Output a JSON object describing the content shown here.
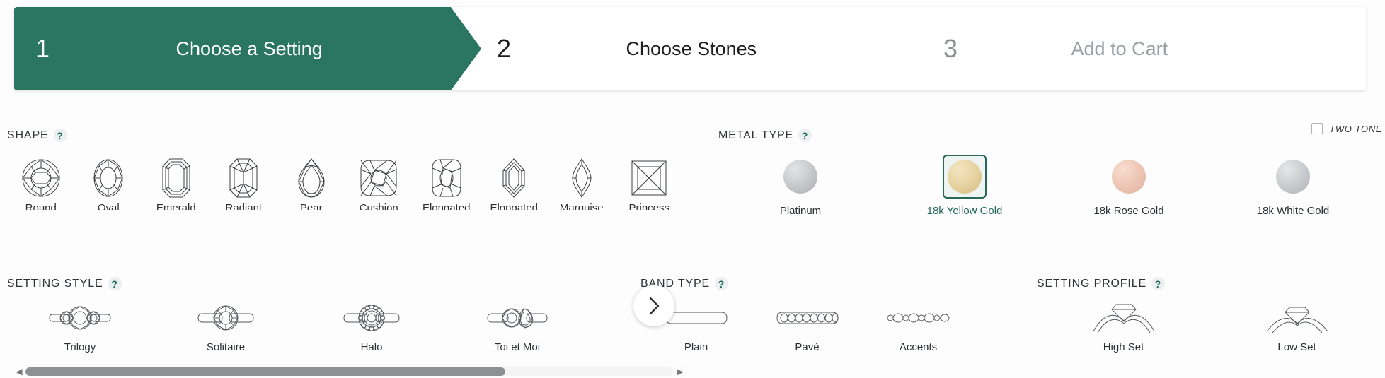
{
  "stepper": {
    "steps": [
      {
        "number": "1",
        "label": "Choose a Setting",
        "state": "active"
      },
      {
        "number": "2",
        "label": "Choose Stones",
        "state": "upcoming"
      },
      {
        "number": "3",
        "label": "Add to Cart",
        "state": "disabled"
      }
    ],
    "active_color": "#2b7563"
  },
  "shape": {
    "title": "SHAPE",
    "help": "?",
    "next_arrow": "chevron-right",
    "scroll_left_arrow": "◀",
    "scroll_right_arrow": "▶",
    "scroll_thumb_percent": 74,
    "options": [
      {
        "label": "Round",
        "icon": "round-diamond-icon"
      },
      {
        "label": "Oval",
        "icon": "oval-diamond-icon"
      },
      {
        "label": "Emerald",
        "icon": "emerald-diamond-icon"
      },
      {
        "label": "Radiant",
        "icon": "radiant-diamond-icon"
      },
      {
        "label": "Pear",
        "icon": "pear-diamond-icon"
      },
      {
        "label": "Cushion",
        "icon": "cushion-diamond-icon"
      },
      {
        "label": "Elongated Cushion",
        "icon": "elongated-cushion-diamond-icon"
      },
      {
        "label": "Elongated Hexagon",
        "icon": "elongated-hexagon-diamond-icon"
      },
      {
        "label": "Marquise",
        "icon": "marquise-diamond-icon"
      },
      {
        "label": "Princess",
        "icon": "princess-diamond-icon"
      }
    ]
  },
  "metal": {
    "title": "METAL TYPE",
    "help": "?",
    "two_tone_label": "TWO TONE",
    "two_tone_checked": false,
    "selected": "18k Yellow Gold",
    "options": [
      {
        "label": "Platinum",
        "color": "#c3c6c8",
        "selected": false
      },
      {
        "label": "18k Yellow Gold",
        "color": "#e8d3a4",
        "selected": true
      },
      {
        "label": "18k Rose Gold",
        "color": "#eec6b4",
        "selected": false
      },
      {
        "label": "18k White Gold",
        "color": "#c5c8ca",
        "selected": false
      }
    ]
  },
  "setting_style": {
    "title": "SETTING STYLE",
    "help": "?",
    "options": [
      {
        "label": "Trilogy",
        "icon": "trilogy-ring-icon"
      },
      {
        "label": "Solitaire",
        "icon": "solitaire-ring-icon"
      },
      {
        "label": "Halo",
        "icon": "halo-ring-icon"
      },
      {
        "label": "Toi et Moi",
        "icon": "toi-et-moi-ring-icon"
      }
    ]
  },
  "band_type": {
    "title": "BAND TYPE",
    "help": "?",
    "options": [
      {
        "label": "Plain",
        "icon": "plain-band-icon"
      },
      {
        "label": "Pavé",
        "icon": "pave-band-icon"
      },
      {
        "label": "Accents",
        "icon": "accents-band-icon"
      }
    ]
  },
  "setting_profile": {
    "title": "SETTING PROFILE",
    "help": "?",
    "options": [
      {
        "label": "High Set",
        "icon": "high-set-profile-icon"
      },
      {
        "label": "Low Set",
        "icon": "low-set-profile-icon"
      }
    ]
  }
}
